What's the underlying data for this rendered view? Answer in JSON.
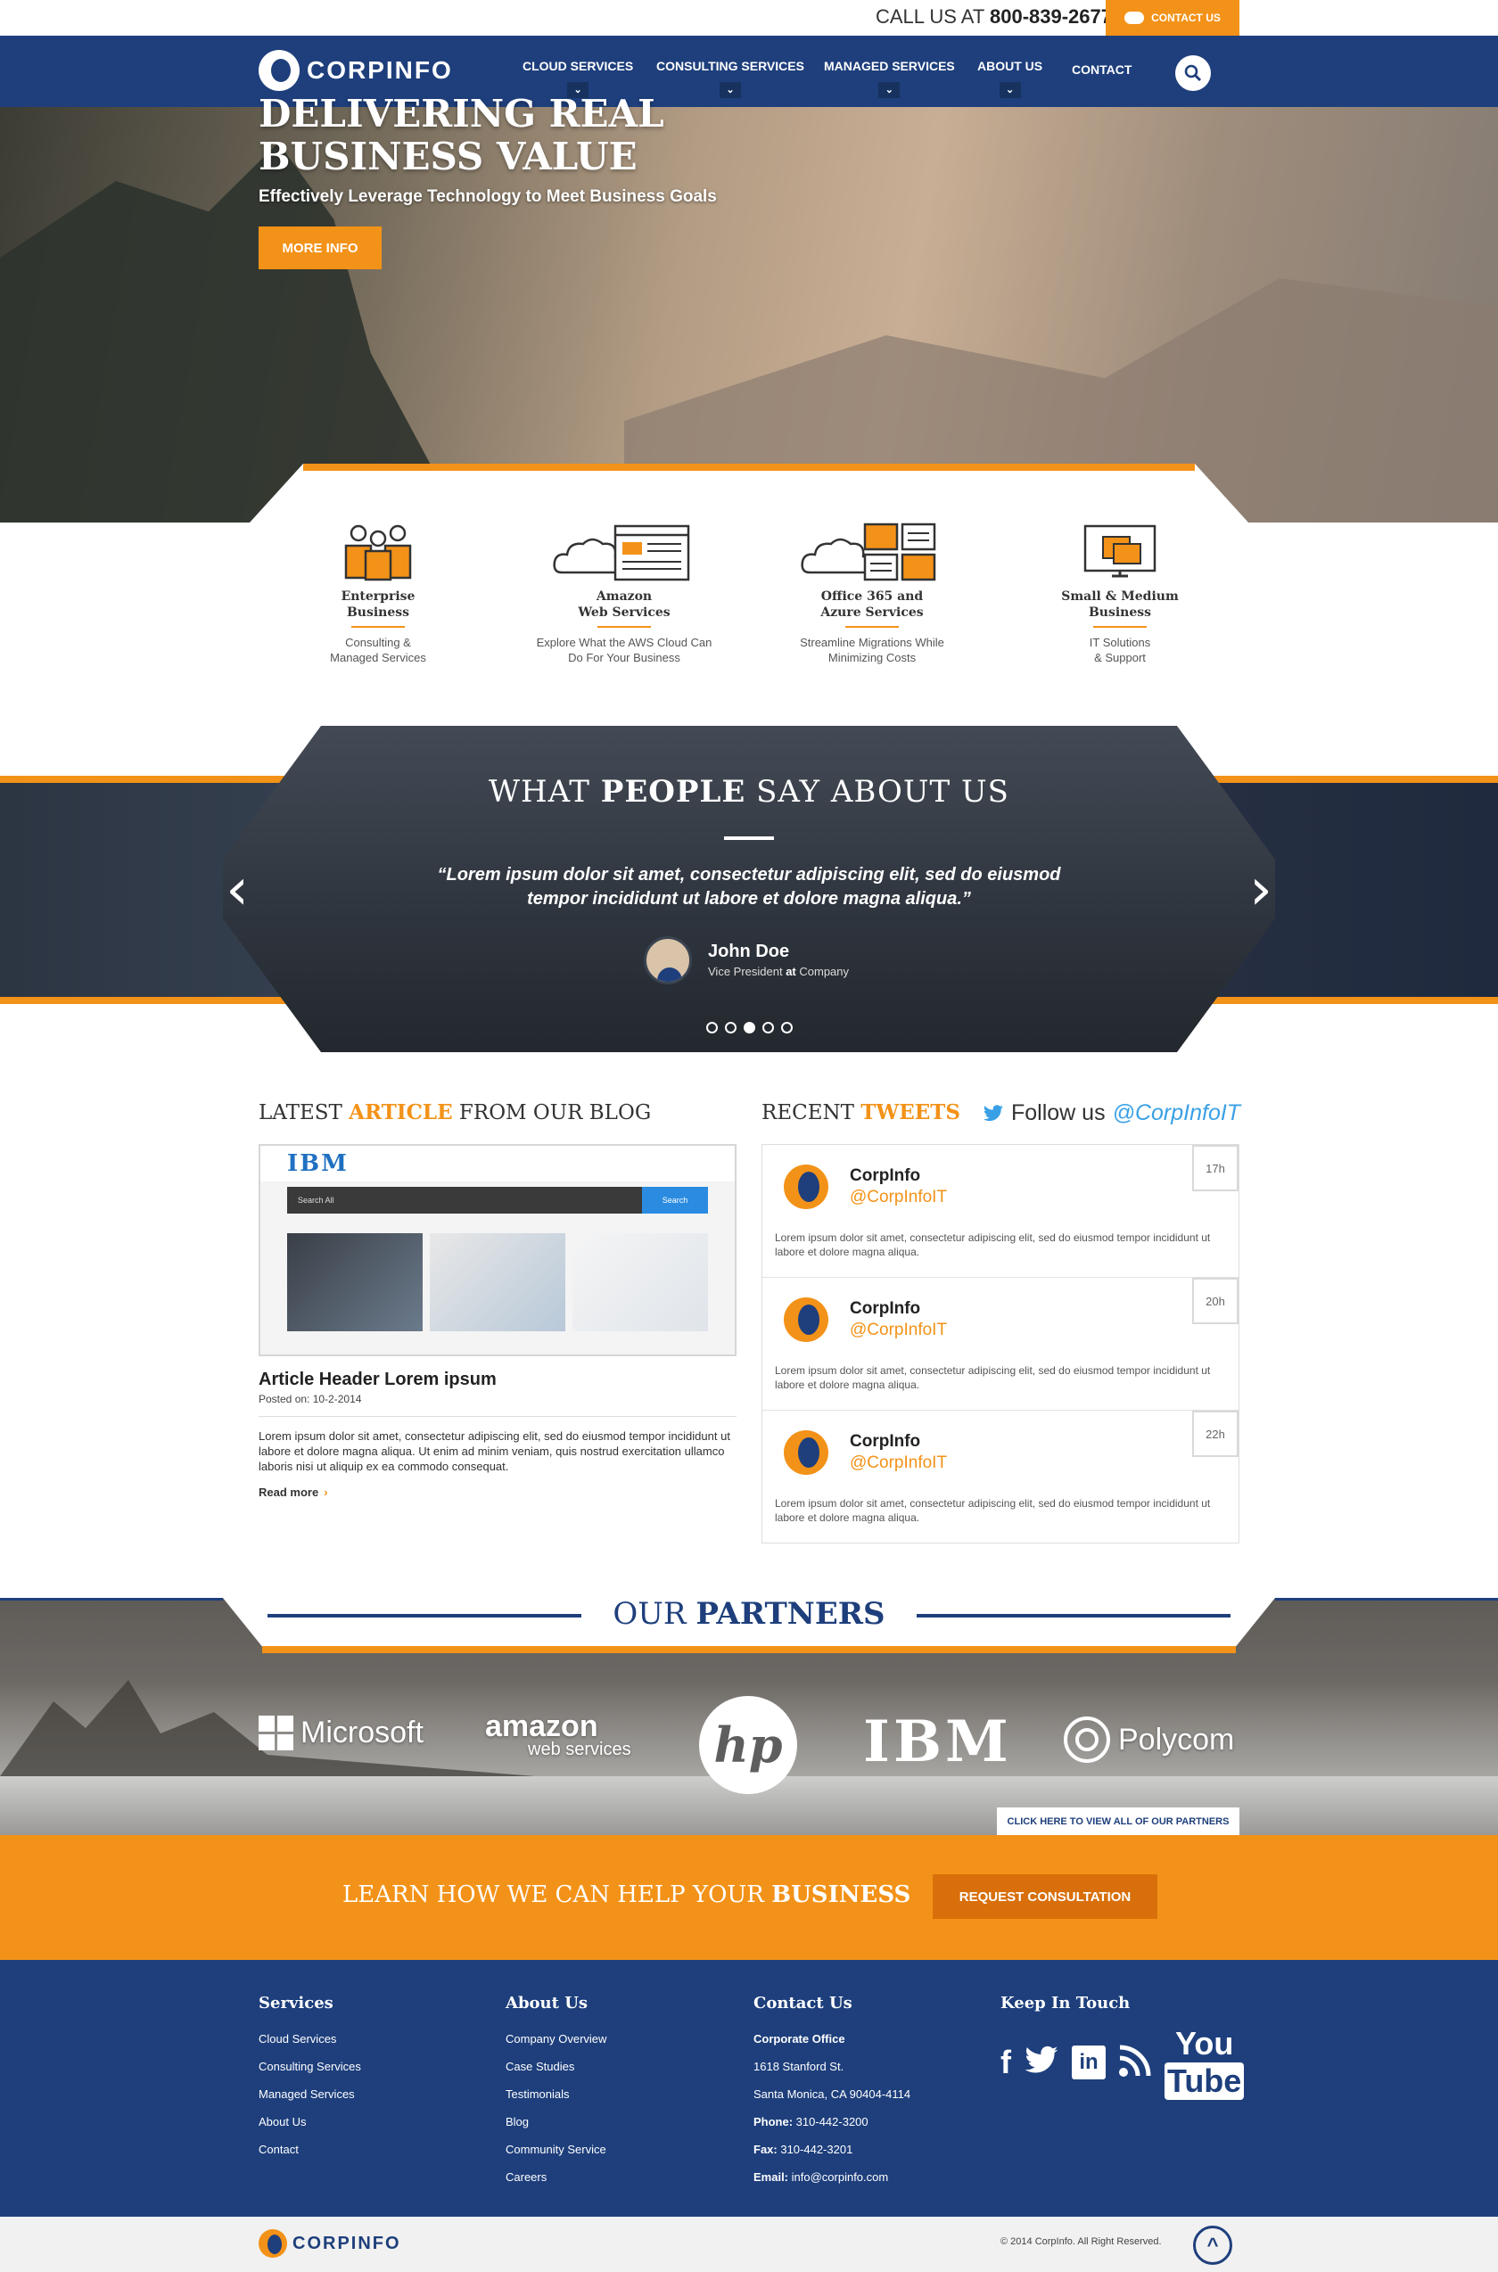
{
  "topbar": {
    "call_prefix": "CALL US AT ",
    "phone": "800-839-2677",
    "contact_label": "CONTACT US"
  },
  "brand": {
    "name": "CORPINFO",
    "bottom_name": "CORPINFO"
  },
  "nav": {
    "items": [
      {
        "label": "CLOUD SERVICES"
      },
      {
        "label": "CONSULTING SERVICES"
      },
      {
        "label": "MANAGED SERVICES"
      },
      {
        "label": "ABOUT US"
      },
      {
        "label": "CONTACT"
      }
    ],
    "search_icon": "search-icon"
  },
  "hero": {
    "title_line1": "DELIVERING REAL",
    "title_line2": "BUSINESS VALUE",
    "subtitle": "Effectively Leverage Technology to Meet Business Goals",
    "button": "MORE INFO"
  },
  "services": [
    {
      "title1": "Enterprise",
      "title2": "Business",
      "desc1": "Consulting &",
      "desc2": "Managed Services",
      "icon": "people-icon"
    },
    {
      "title1": "Amazon",
      "title2": "Web Services",
      "desc1": "Explore What the AWS Cloud Can",
      "desc2": "Do For Your Business",
      "icon": "cloud-browser-icon"
    },
    {
      "title1": "Office 365 and",
      "title2": "Azure Services",
      "desc1": "Streamline Migrations While",
      "desc2": "Minimizing Costs",
      "icon": "cloud-windows-icon"
    },
    {
      "title1": "Small & Medium",
      "title2": "Business",
      "desc1": "IT Solutions",
      "desc2": "& Support",
      "icon": "monitor-icon"
    }
  ],
  "testimonial": {
    "title_pre": "WHAT ",
    "title_bold": "PEOPLE",
    "title_post": " SAY ABOUT US",
    "quote_line1": "“Lorem ipsum dolor sit amet, consectetur adipiscing elit, sed do eiusmod",
    "quote_line2": "tempor incididunt ut labore et dolore magna aliqua.”",
    "name": "John Doe",
    "role_pre": "Vice President ",
    "role_at": "at",
    "role_post": " Company",
    "prev": "‹",
    "next": "›",
    "active_dot": 3,
    "dot_count": 5
  },
  "blog": {
    "title_pre": "LATEST ",
    "title_bold": "ARTICLE",
    "title_post": " FROM OUR BLOG",
    "image_brand": "IBM",
    "image_search": "Search All",
    "image_search_btn": "Search",
    "header": "Article Header Lorem ipsum",
    "date": "Posted on: 10-2-2014",
    "body": "Lorem ipsum dolor sit amet, consectetur adipiscing elit, sed do eiusmod tempor incididunt ut labore et dolore magna aliqua. Ut enim ad minim veniam, quis nostrud exercitation ullamco laboris nisi ut aliquip ex ea commodo consequat.",
    "read_more": "Read more",
    "read_more_arrow": "›"
  },
  "tweets": {
    "title_pre": "RECENT ",
    "title_bold": "TWEETS",
    "follow_pre": "Follow us ",
    "follow_handle": "@CorpInfoIT",
    "items": [
      {
        "name": "CorpInfo",
        "handle": "@CorpInfoIT",
        "text": "Lorem ipsum dolor sit amet, consectetur adipiscing elit, sed do eiusmod tempor incididunt ut labore et dolore magna aliqua.",
        "time": "17h"
      },
      {
        "name": "CorpInfo",
        "handle": "@CorpInfoIT",
        "text": "Lorem ipsum dolor sit amet, consectetur adipiscing elit, sed do eiusmod tempor incididunt ut labore et dolore magna aliqua.",
        "time": "20h"
      },
      {
        "name": "CorpInfo",
        "handle": "@CorpInfoIT",
        "text": "Lorem ipsum dolor sit amet, consectetur adipiscing elit, sed do eiusmod tempor incididunt ut labore et dolore magna aliqua.",
        "time": "22h"
      }
    ]
  },
  "partners": {
    "title_pre": "OUR ",
    "title_bold": "PARTNERS",
    "logos": {
      "microsoft": "Microsoft",
      "amazon1": "amazon",
      "amazon2": "web services",
      "hp": "hp",
      "ibm": "IBM",
      "polycom": "Polycom"
    },
    "view_all": "CLICK HERE TO VIEW ALL OF OUR PARTNERS"
  },
  "cta": {
    "text_pre": "LEARN HOW WE CAN HELP YOUR ",
    "text_bold": "BUSINESS",
    "button": "REQUEST CONSULTATION"
  },
  "footer": {
    "services": {
      "title": "Services",
      "links": [
        "Cloud Services",
        "Consulting Services",
        "Managed Services",
        "About Us",
        "Contact"
      ]
    },
    "about": {
      "title": "About Us",
      "links": [
        "Company Overview",
        "Case Studies",
        "Testimonials",
        "Blog",
        "Community Service",
        "Careers"
      ]
    },
    "contact": {
      "title": "Contact Us",
      "office": "Corporate Office",
      "street": "1618 Stanford St.",
      "city": "Santa Monica, CA 90404-4114",
      "phone_label": "Phone:",
      "phone": " 310-442-3200",
      "fax_label": "Fax:",
      "fax": " 310-442-3201",
      "email_label": "Email:",
      "email": " info@corpinfo.com"
    },
    "social": {
      "title": "Keep In Touch",
      "facebook": "f",
      "linkedin": "in",
      "youtube1": "You",
      "youtube2": "Tube"
    },
    "copyright": "© 2014 CorpInfo. All Right Reserved.",
    "to_top": "^"
  },
  "colors": {
    "navy": "#1e3f7c",
    "orange": "#f39218",
    "twitter": "#3aa0e6"
  }
}
